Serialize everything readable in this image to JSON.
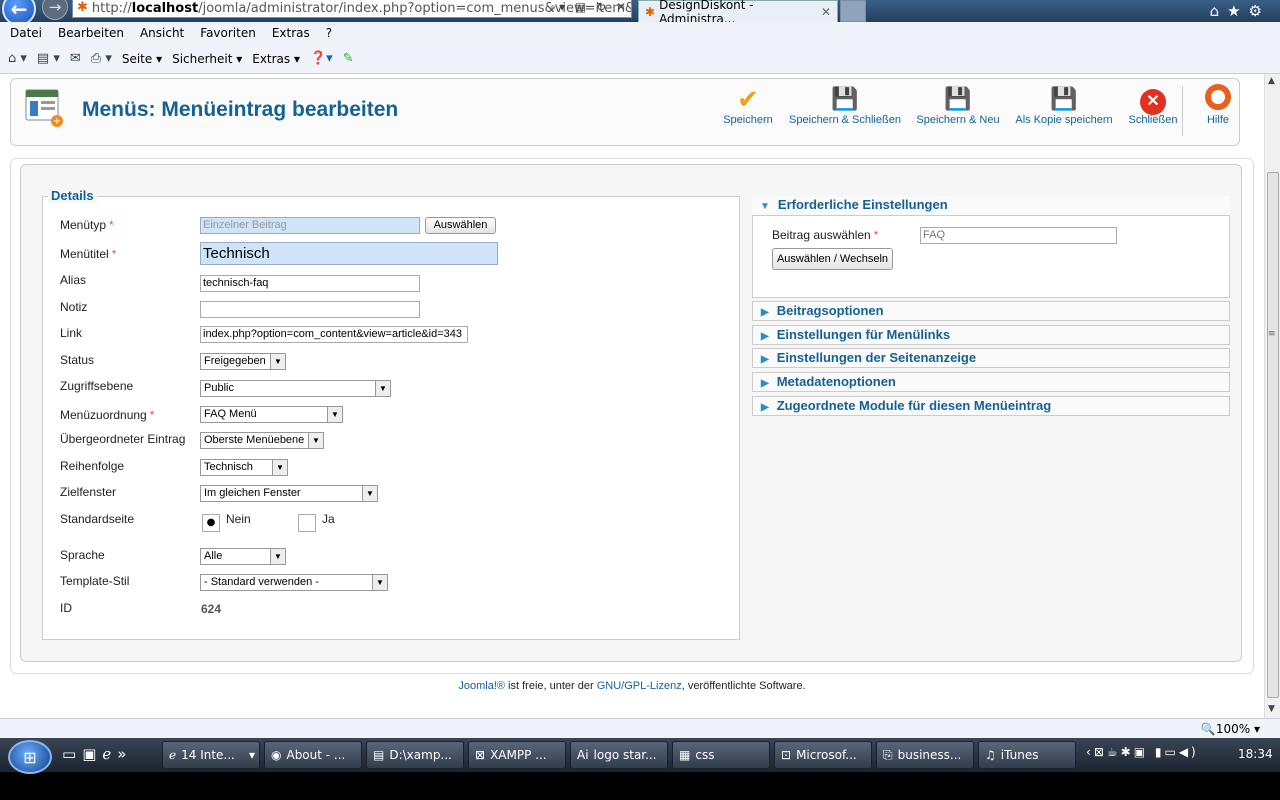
{
  "browser": {
    "address_prefix": "http://",
    "address_host": "localhost",
    "address_path": "/joomla/administrator/index.php?option=com_menus&view=item&l",
    "tab_title": "DesignDiskont - Administra...",
    "tab_close": "✕",
    "menu": [
      "Datei",
      "Bearbeiten",
      "Ansicht",
      "Favoriten",
      "Extras",
      "?"
    ],
    "commands": {
      "seite": "Seite ▾",
      "sicherheit": "Sicherheit ▾",
      "extras": "Extras ▾"
    },
    "zoom": "100%"
  },
  "toolbar": {
    "title": "Menüs: Menüeintrag bearbeiten",
    "buttons": {
      "save": "Speichern",
      "save_close": "Speichern & Schließen",
      "save_new": "Speichern & Neu",
      "save_copy": "Als Kopie speichern",
      "close": "Schließen",
      "help": "Hilfe"
    }
  },
  "details": {
    "legend": "Details",
    "labels": {
      "menutype": "Menütyp",
      "title": "Menütitel",
      "alias": "Alias",
      "note": "Notiz",
      "link": "Link",
      "status": "Status",
      "access": "Zugriffsebene",
      "menu": "Menüzuordnung",
      "parent": "Übergeordneter Eintrag",
      "order": "Reihenfolge",
      "target": "Zielfenster",
      "default": "Standardseite",
      "language": "Sprache",
      "template": "Template-Stil",
      "id": "ID"
    },
    "required_mark": "*",
    "values": {
      "menutype": "Einzelner Beitrag",
      "menutype_button": "Auswählen",
      "title": "Technisch",
      "alias": "technisch-faq",
      "note": "",
      "link": "index.php?option=com_content&view=article&id=343",
      "status": "Freigegeben",
      "access": "Public",
      "menu": "FAQ Menü",
      "parent": "Oberste Menüebene",
      "order": "Technisch",
      "target": "Im gleichen Fenster",
      "default_no": "Nein",
      "default_yes": "Ja",
      "default_selected": "Nein",
      "language": "Alle",
      "template": "- Standard verwenden -",
      "id": "624"
    }
  },
  "required_settings": {
    "header": "Erforderliche Einstellungen",
    "article_label": "Beitrag auswählen",
    "article_value": "FAQ",
    "select_button": "Auswählen / Wechseln"
  },
  "sections": [
    "Beitragsoptionen",
    "Einstellungen für Menülinks",
    "Einstellungen der Seitenanzeige",
    "Metadatenoptionen",
    "Zugeordnete Module für diesen Menüeintrag"
  ],
  "footer": {
    "joomla": "Joomla!®",
    "text1": " ist freie, unter der ",
    "license": "GNU/GPL-Lizenz",
    "text2": ", veröffentlichte Software."
  },
  "taskbar": {
    "items": [
      {
        "label": "14 Inte...",
        "icon": "ie-icon"
      },
      {
        "label": "About - ...",
        "icon": "firefox-icon"
      },
      {
        "label": "D:\\xamp...",
        "icon": "editor-icon"
      },
      {
        "label": "XAMPP ...",
        "icon": "xampp-icon"
      },
      {
        "label": "logo star...",
        "icon": "illustrator-icon"
      },
      {
        "label": "css",
        "icon": "css-icon"
      },
      {
        "label": "Microsof...",
        "icon": "excel-icon"
      },
      {
        "label": "business...",
        "icon": "pdf-icon"
      },
      {
        "label": "iTunes",
        "icon": "itunes-icon"
      }
    ],
    "clock": "18:34"
  }
}
